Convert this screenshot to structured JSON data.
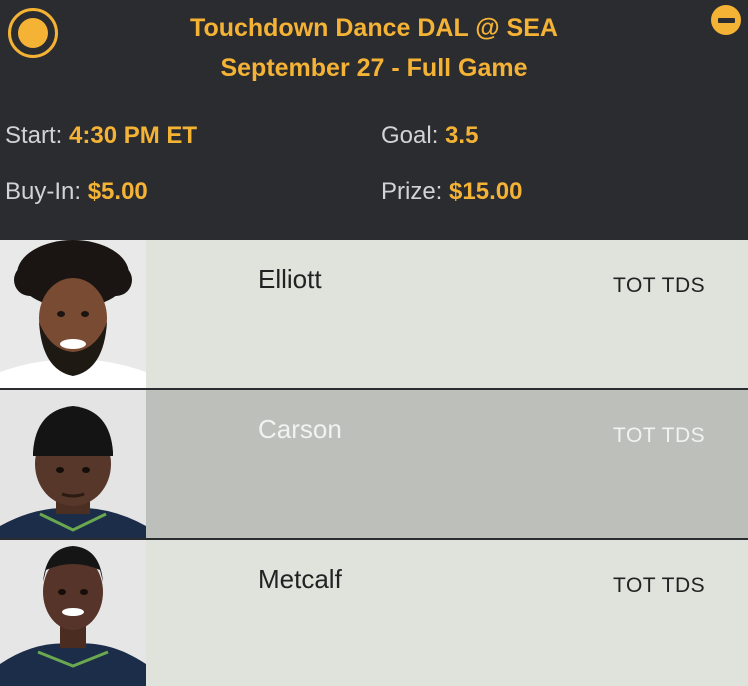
{
  "header": {
    "title_line1": "Touchdown Dance DAL @ SEA",
    "title_line2": "September 27 - Full Game",
    "start_label": "Start:",
    "start_value": "4:30 PM ET",
    "goal_label": "Goal:",
    "goal_value": "3.5",
    "buyin_label": "Buy-In:",
    "buyin_value": "$5.00",
    "prize_label": "Prize:",
    "prize_value": "$15.00"
  },
  "players": [
    {
      "name": "Elliott",
      "stat": "TOT TDS"
    },
    {
      "name": "Carson",
      "stat": "TOT TDS"
    },
    {
      "name": "Metcalf",
      "stat": "TOT TDS"
    }
  ],
  "colors": {
    "accent": "#f5b335",
    "header_bg": "#2b2c30",
    "row_light": "#e0e2dc",
    "row_selected": "#bdbfba"
  }
}
